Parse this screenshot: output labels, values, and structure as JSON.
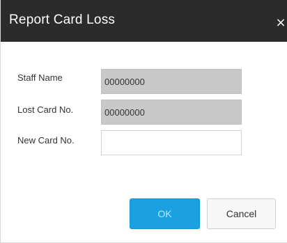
{
  "dialog": {
    "title": "Report Card Loss",
    "close_label": "×"
  },
  "form": {
    "staff_name": {
      "label": "Staff Name",
      "value": "00000000"
    },
    "lost_card_no": {
      "label": "Lost Card No.",
      "value": "00000000"
    },
    "new_card_no": {
      "label": "New Card No.",
      "value": ""
    }
  },
  "buttons": {
    "ok_label": "OK",
    "cancel_label": "Cancel"
  },
  "colors": {
    "titlebar": "#2b2b2b",
    "ok_button": "#1ba1e2",
    "readonly_field": "#c8c8c8"
  }
}
